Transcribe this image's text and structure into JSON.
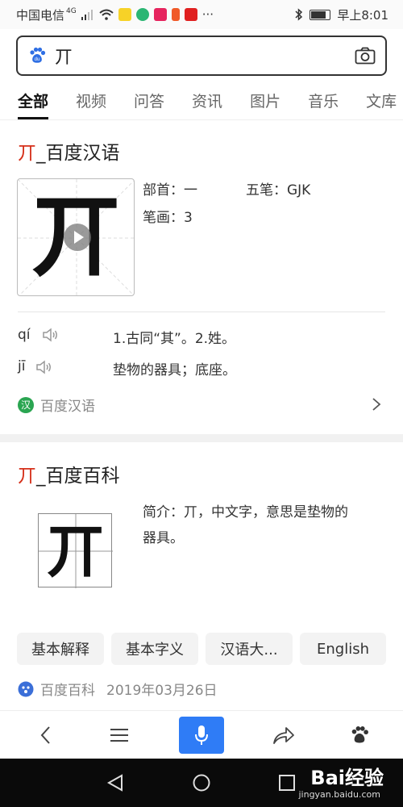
{
  "status_bar": {
    "carrier": "中国电信",
    "network": "4G",
    "time": "早上8:01",
    "more": "···"
  },
  "search": {
    "query": "丌"
  },
  "tabs": [
    {
      "label": "全部",
      "active": true
    },
    {
      "label": "视频"
    },
    {
      "label": "问答"
    },
    {
      "label": "资讯"
    },
    {
      "label": "图片"
    },
    {
      "label": "音乐"
    },
    {
      "label": "文库"
    }
  ],
  "card1": {
    "title_char": "丌",
    "title_rest": "_百度汉语",
    "char": "丌",
    "radical": "部首：一",
    "wubi": "五笔：GJK",
    "strokes": "笔画：3",
    "readings": [
      {
        "pinyin": "qí",
        "definition": "1.古同“其”。2.姓。"
      },
      {
        "pinyin": "jī",
        "definition": "垫物的器具；底座。"
      }
    ],
    "source_badge": "汉",
    "source": "百度汉语"
  },
  "card2": {
    "title_char": "丌",
    "title_rest": "_百度百科",
    "char": "丌",
    "intro_line1": "简介：丌，中文字，意思是垫物的",
    "intro_line2": "器具。",
    "pills": [
      "基本解释",
      "基本字义",
      "汉语大...",
      "English"
    ],
    "source": "百度百科",
    "date": "2019年03月26日"
  },
  "watermark": {
    "brand": "Bai经验",
    "url": "jingyan.baidu.com"
  },
  "colors": {
    "accent_red": "#d5301a",
    "mic_blue": "#2f7cf6",
    "source_green": "#2aa551",
    "baike_blue": "#3b6fd8"
  }
}
